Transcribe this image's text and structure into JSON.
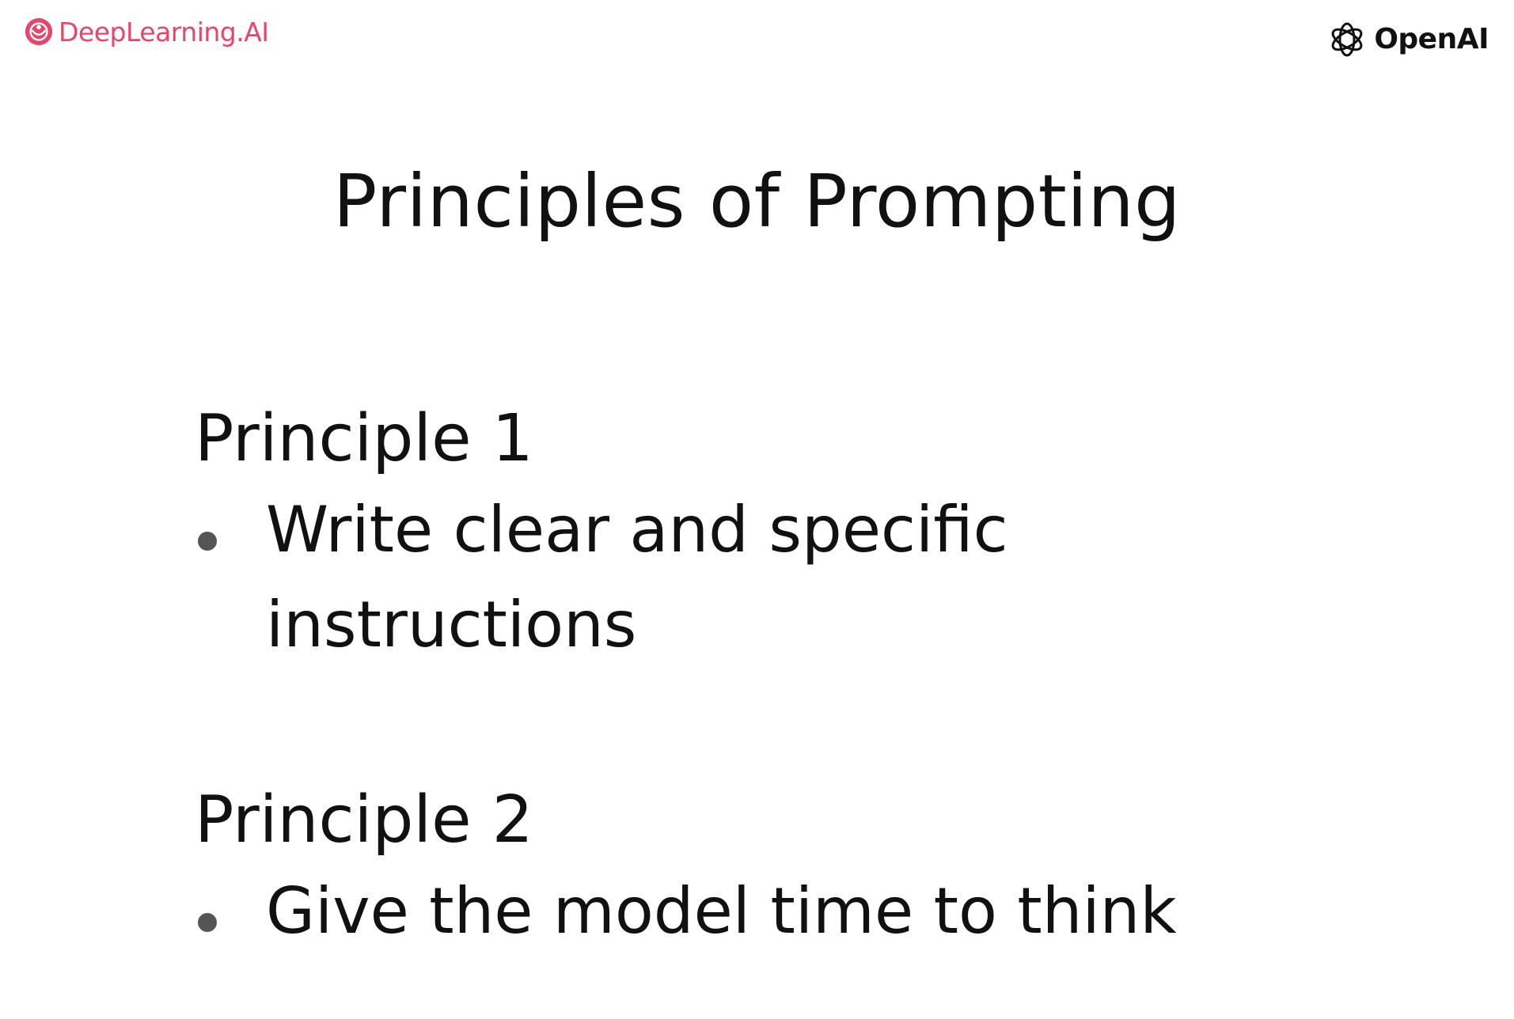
{
  "header": {
    "left_logo_text": "DeepLearning.AI",
    "left_logo_icon": "deeplearning-ai-logo-icon",
    "right_logo_text": "OpenAI",
    "right_logo_icon": "openai-logo-icon",
    "brand_color": "#e8456b"
  },
  "slide": {
    "title": "Principles of Prompting",
    "principles": [
      {
        "heading": "Principle 1",
        "bullets": [
          "Write clear and specific instructions"
        ]
      },
      {
        "heading": "Principle 2",
        "bullets": [
          "Give the model time to think"
        ]
      }
    ]
  }
}
